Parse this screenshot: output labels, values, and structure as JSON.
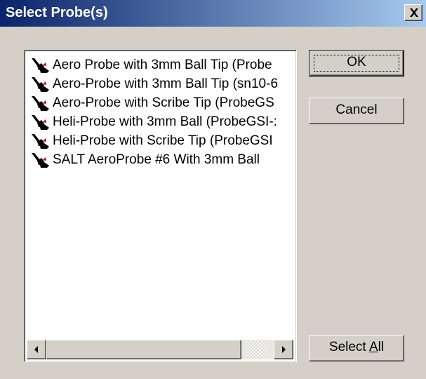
{
  "window": {
    "title": "Select Probe(s)"
  },
  "probes": [
    {
      "label": "Aero Probe with 3mm Ball Tip (Probe"
    },
    {
      "label": "Aero-Probe with 3mm Ball Tip (sn10-6"
    },
    {
      "label": "Aero-Probe with Scribe Tip (ProbeGS"
    },
    {
      "label": "Heli-Probe with 3mm Ball (ProbeGSI-:"
    },
    {
      "label": "Heli-Probe with Scribe Tip (ProbeGSI"
    },
    {
      "label": "SALT AeroProbe #6 With 3mm Ball"
    }
  ],
  "buttons": {
    "ok": "OK",
    "cancel": "Cancel",
    "select_all_prefix": "Select ",
    "select_all_accel": "A",
    "select_all_suffix": "ll"
  },
  "icons": {
    "probe": "probe-icon",
    "close": "close-icon",
    "scroll_left": "arrow-left-icon",
    "scroll_right": "arrow-right-icon"
  },
  "colors": {
    "titlebar_start": "#0a246a",
    "titlebar_end": "#a6caf0",
    "face": "#d4d0c8"
  }
}
